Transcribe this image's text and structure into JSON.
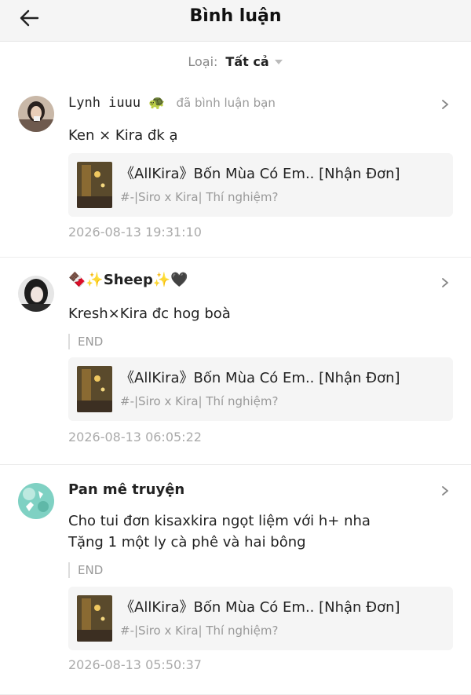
{
  "header": {
    "title": "Bình luận",
    "back_icon": "arrow-left-icon"
  },
  "filter": {
    "label": "Loại:",
    "value": "Tất cả"
  },
  "comments": [
    {
      "user": "Lynh iuuu 🐢",
      "action": "đã bình luận bạn",
      "text": "Ken × Kira đk ạ",
      "card_title": "《AllKira》Bốn Mùa Có Em.. [Nhận Đơn]",
      "card_sub": "#-|Siro x Kira| Thí nghiệm?",
      "time": "2026-08-13 19:31:10"
    },
    {
      "user": "🍫✨Sheep✨🖤",
      "text": "Kresh×Kira đc hog boà",
      "end": "END",
      "card_title": "《AllKira》Bốn Mùa Có Em.. [Nhận Đơn]",
      "card_sub": "#-|Siro x Kira| Thí nghiệm?",
      "time": "2026-08-13 06:05:22"
    },
    {
      "user": "Pan mê truyện",
      "text": "Cho tui đơn kisaxkira ngọt liệm với h+ nha",
      "text2": "Tặng 1 một ly cà phê và hai bông",
      "end": "END",
      "card_title": "《AllKira》Bốn Mùa Có Em.. [Nhận Đơn]",
      "card_sub": "#-|Siro x Kira| Thí nghiệm?",
      "time": "2026-08-13 05:50:37"
    }
  ]
}
